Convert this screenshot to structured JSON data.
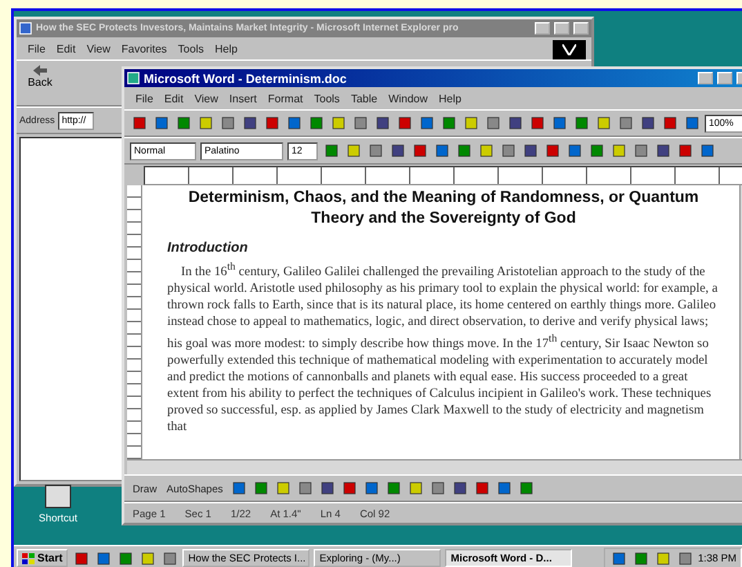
{
  "browser_window": {
    "title": "How the SEC Protects Investors, Maintains Market Integrity - Microsoft Internet Explorer pro",
    "menu": [
      "File",
      "Edit",
      "View",
      "Favorites",
      "Tools",
      "Help"
    ],
    "back_label": "Back",
    "address_label": "Address",
    "address_value": "http://"
  },
  "word_window": {
    "title": "Microsoft Word - Determinism.doc",
    "menu": [
      "File",
      "Edit",
      "View",
      "Insert",
      "Format",
      "Tools",
      "Table",
      "Window",
      "Help"
    ],
    "zoom": "100%",
    "style": "Normal",
    "font": "Palatino",
    "size": "12",
    "document": {
      "title": "Determinism, Chaos, and the Meaning of Randomness, or Quantum Theory and the Sovereignty of God",
      "heading": "Introduction",
      "paragraph": "In the 16$^{th}$ century, Galileo Galilei challenged the prevailing Aristotelian approach to the study of the physical world.  Aristotle used philosophy as his primary tool to explain the physical world: for example, a thrown rock falls to Earth, since that is its natural place, its home centered on earthly things more.  Galileo instead chose to appeal to mathematics, logic, and direct observation, to derive and verify physical laws; his goal was more modest: to simply describe how things move.  In the 17$^{th}$ century, Sir Isaac Newton so powerfully extended this technique of mathematical modeling with experimentation to accurately model and predict the motions of cannonballs and planets with equal ease.  His success proceeded to a great extent from his ability to perfect the techniques of Calculus incipient in Galileo's work.  These techniques proved so successful, esp. as applied by James Clark Maxwell to the study of electricity and magnetism that"
    },
    "drawing_toolbar": [
      "Draw",
      "AutoShapes"
    ],
    "status_bar": [
      "Page 1",
      "Sec 1",
      "1/22",
      "At 1.4\"",
      "Ln 4",
      "Col 92"
    ]
  },
  "desktop_icon": {
    "label": "Shortcut"
  },
  "taskbar": {
    "start": "Start",
    "tasks": [
      {
        "label": "How the SEC Protects I...",
        "selected": false
      },
      {
        "label": "Exploring - (My...)",
        "selected": false
      },
      {
        "label": "Microsoft Word - D...",
        "selected": true
      }
    ],
    "clock": "1:38 PM"
  }
}
